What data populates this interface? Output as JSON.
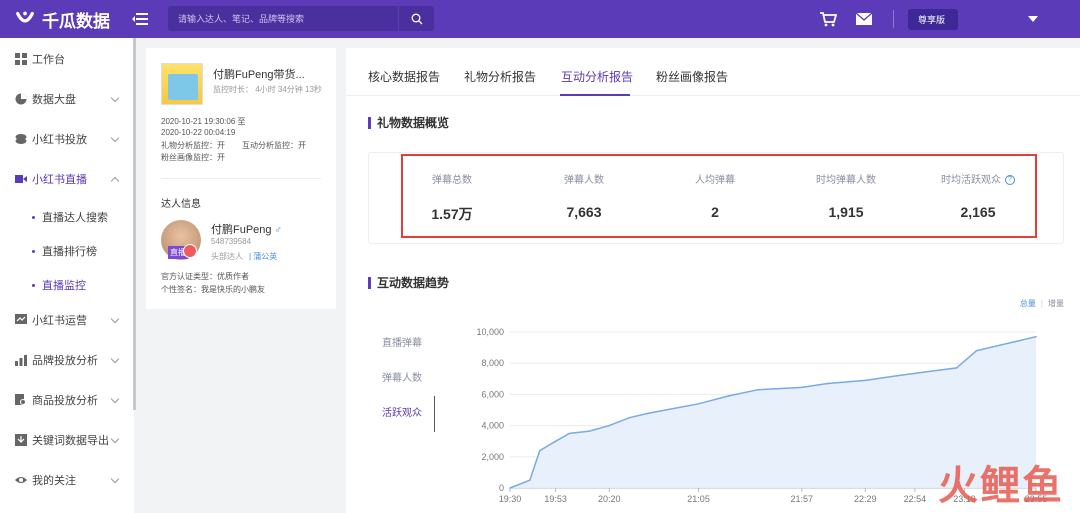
{
  "app": {
    "name": "千瓜数据"
  },
  "search": {
    "placeholder": "请输入达人、笔记、品牌等搜索"
  },
  "header": {
    "plan_badge": "尊享版"
  },
  "sidebar": {
    "items": [
      {
        "label": "工作台",
        "icon": "grid-icon"
      },
      {
        "label": "数据大盘",
        "icon": "pie-icon"
      },
      {
        "label": "小红书投放",
        "icon": "coin-icon"
      },
      {
        "label": "小红书直播",
        "icon": "video-icon"
      },
      {
        "label": "小红书运营",
        "icon": "chart-icon"
      },
      {
        "label": "品牌投放分析",
        "icon": "bar-icon"
      },
      {
        "label": "商品投放分析",
        "icon": "doc-search-icon"
      },
      {
        "label": "关键词数据导出",
        "icon": "download-icon"
      },
      {
        "label": "我的关注",
        "icon": "eye-icon"
      }
    ],
    "live_sub": [
      "直播达人搜索",
      "直播排行榜",
      "直播监控"
    ]
  },
  "live": {
    "title": "付鹏FuPeng带货...",
    "monitor_duration": "监控时长： 4小时 34分钟 13秒",
    "time_start": "2020-10-21 19:30:06 至",
    "time_end": "2020-10-22 00:04:19",
    "gift_monitor": "礼物分析监控：开",
    "interact_monitor": "互动分析监控：开",
    "fans_monitor": "粉丝画像监控：开"
  },
  "kol": {
    "section": "达人信息",
    "avatar_tag": "直播",
    "name": "付鹏FuPeng",
    "id": "548739584",
    "tag": "头部达人",
    "link": "| 蒲公英",
    "cert": "官方认证类型：优质作者",
    "sign": "个性签名：我是快乐的小鹏友"
  },
  "tabs": [
    "核心数据报告",
    "礼物分析报告",
    "互动分析报告",
    "粉丝画像报告"
  ],
  "gift_overview": {
    "title": "礼物数据概览",
    "stats": [
      {
        "label": "弹幕总数",
        "value": "1.57万"
      },
      {
        "label": "弹幕人数",
        "value": "7,663"
      },
      {
        "label": "人均弹幕",
        "value": "2"
      },
      {
        "label": "时均弹幕人数",
        "value": "1,915"
      },
      {
        "label": "时均活跃观众",
        "value": "2,165"
      }
    ]
  },
  "trend": {
    "title": "互动数据趋势",
    "toggle_total": "总量",
    "toggle_increment": "增量",
    "metrics": [
      "直播弹幕",
      "弹幕人数",
      "活跃观众"
    ]
  },
  "watermark": "火鲤鱼",
  "chart_data": {
    "type": "area",
    "x": [
      "19:30",
      "19:40",
      "19:45",
      "19:53",
      "20:00",
      "20:10",
      "20:20",
      "20:30",
      "20:40",
      "21:05",
      "21:20",
      "21:35",
      "21:57",
      "22:10",
      "22:29",
      "22:45",
      "23:00",
      "23:15",
      "23:25",
      "23:45",
      "23:55"
    ],
    "values": [
      0,
      500,
      2400,
      3000,
      3500,
      3650,
      4000,
      4500,
      4800,
      5400,
      5900,
      6300,
      6450,
      6700,
      6900,
      7200,
      7450,
      7700,
      8800,
      9400,
      9700
    ],
    "x_ticks": [
      "19:30",
      "19:53",
      "20:20",
      "21:05",
      "21:57",
      "22:29",
      "22:54",
      "23:19",
      "23:55"
    ],
    "y_ticks": [
      "0",
      "2,000",
      "4,000",
      "6,000",
      "8,000",
      "10,000"
    ],
    "ylim": [
      0,
      10000
    ],
    "grid": true,
    "color": "#7aa9e8"
  }
}
